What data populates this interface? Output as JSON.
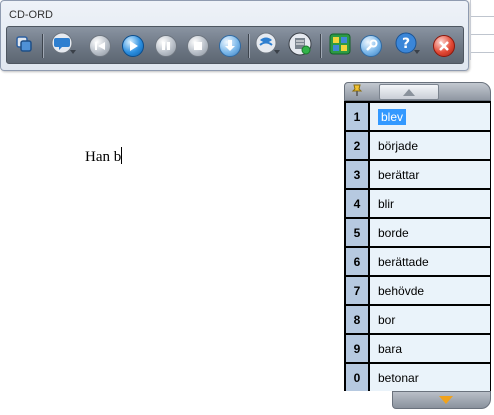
{
  "toolbar": {
    "title": "CD-ORD",
    "buttons": [
      {
        "name": "switch-window-icon"
      },
      {
        "name": "speech-bubble-icon"
      },
      {
        "name": "previous-icon"
      },
      {
        "name": "play-icon"
      },
      {
        "name": "pause-icon"
      },
      {
        "name": "stop-icon"
      },
      {
        "name": "download-icon"
      },
      {
        "name": "dictionary-icon"
      },
      {
        "name": "database-icon"
      },
      {
        "name": "word-prediction-icon"
      },
      {
        "name": "settings-icon"
      },
      {
        "name": "help-icon"
      },
      {
        "name": "close-icon"
      }
    ]
  },
  "document": {
    "text": "Han b"
  },
  "prediction": {
    "items": [
      {
        "num": "1",
        "word": "blev"
      },
      {
        "num": "2",
        "word": "började"
      },
      {
        "num": "3",
        "word": "berättar"
      },
      {
        "num": "4",
        "word": "blir"
      },
      {
        "num": "5",
        "word": "borde"
      },
      {
        "num": "6",
        "word": "berättade"
      },
      {
        "num": "7",
        "word": "behövde"
      },
      {
        "num": "8",
        "word": "bor"
      },
      {
        "num": "9",
        "word": "bara"
      },
      {
        "num": "0",
        "word": "betonar"
      }
    ],
    "selected_index": 0,
    "colors": {
      "number_bg": "#b6c9e0",
      "word_bg": "#eaf3fa",
      "selection": "#3399ff",
      "scroll_down_arrow": "#f0a21c"
    }
  }
}
